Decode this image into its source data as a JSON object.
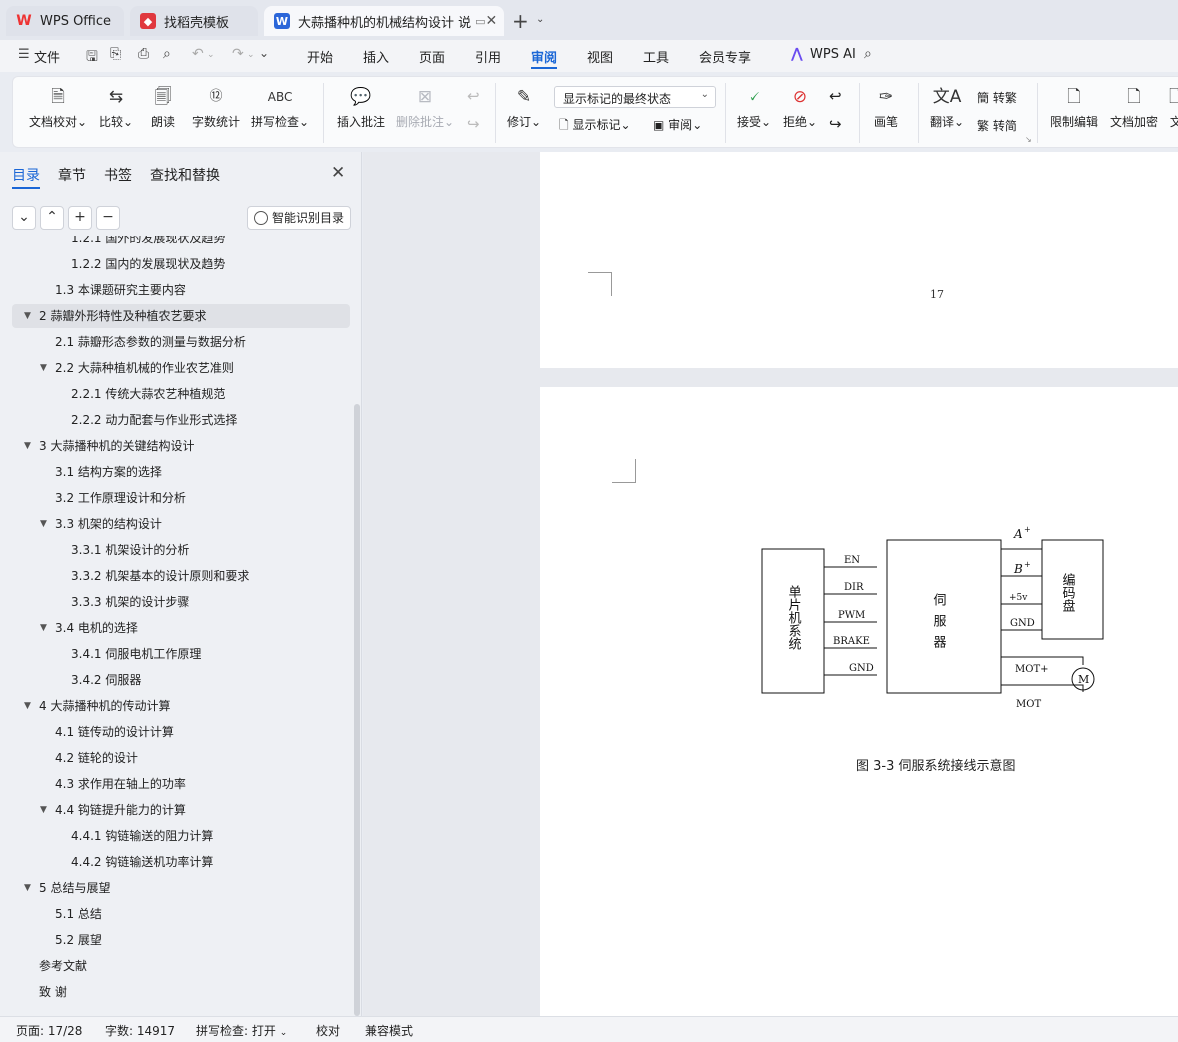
{
  "tabs": [
    {
      "label": "WPS Office"
    },
    {
      "label": "找稻壳模板"
    },
    {
      "label": "大蒜播种机的机械结构设计 说"
    }
  ],
  "menu": {
    "file": "文件",
    "items": [
      "开始",
      "插入",
      "页面",
      "引用",
      "审阅",
      "视图",
      "工具",
      "会员专享"
    ],
    "wps_ai": "WPS AI"
  },
  "ribbon": {
    "proofread": "文档校对",
    "compare": "比较",
    "read_aloud": "朗读",
    "word_count": "字数统计",
    "spell_check": "拼写检查",
    "insert_comment": "插入批注",
    "delete_comment": "删除批注",
    "revise": "修订",
    "markup_state": "显示标记的最终状态",
    "show_markup": "显示标记",
    "review": "审阅",
    "accept": "接受",
    "reject": "拒绝",
    "pen": "画笔",
    "translate": "翻译",
    "to_traditional": "转繁",
    "to_simplified": "转简",
    "restrict_edit": "限制编辑",
    "encrypt": "文档加密",
    "doc_more": "文"
  },
  "nav": {
    "tabs": [
      "目录",
      "章节",
      "书签",
      "查找和替换"
    ],
    "smart_button": "智能识别目录",
    "toc": [
      {
        "label": "1.2.1 国外的发展现状及趋势",
        "level": 3
      },
      {
        "label": "1.2.2 国内的发展现状及趋势",
        "level": 3
      },
      {
        "label": "1.3 本课题研究主要内容",
        "level": 2
      },
      {
        "label": "2  蒜瓣外形特性及种植农艺要求",
        "level": 1,
        "expanded": true,
        "selected": true
      },
      {
        "label": "2.1  蒜瓣形态参数的测量与数据分析",
        "level": 2
      },
      {
        "label": "2.2  大蒜种植机械的作业农艺准则",
        "level": 2,
        "expanded": true
      },
      {
        "label": "2.2.1  传统大蒜农艺种植规范",
        "level": 3
      },
      {
        "label": "2.2.2  动力配套与作业形式选择",
        "level": 3
      },
      {
        "label": "3 大蒜播种机的关键结构设计",
        "level": 1,
        "expanded": true
      },
      {
        "label": "3.1 结构方案的选择",
        "level": 2
      },
      {
        "label": "3.2 工作原理设计和分析",
        "level": 2
      },
      {
        "label": "3.3 机架的结构设计",
        "level": 2,
        "expanded": true
      },
      {
        "label": "3.3.1 机架设计的分析",
        "level": 3
      },
      {
        "label": "3.3.2 机架基本的设计原则和要求",
        "level": 3
      },
      {
        "label": "3.3.3 机架的设计步骤",
        "level": 3
      },
      {
        "label": "3.4 电机的选择",
        "level": 2,
        "expanded": true
      },
      {
        "label": "3.4.1 伺服电机工作原理",
        "level": 3
      },
      {
        "label": "3.4.2 伺服器",
        "level": 3
      },
      {
        "label": "4  大蒜播种机的传动计算",
        "level": 1,
        "expanded": true
      },
      {
        "label": "4.1 链传动的设计计算",
        "level": 2
      },
      {
        "label": "4.2 链轮的设计",
        "level": 2
      },
      {
        "label": "4.3 求作用在轴上的功率",
        "level": 2
      },
      {
        "label": "4.4 钩链提升能力的计算",
        "level": 2,
        "expanded": true
      },
      {
        "label": "4.4.1 钩链输送的阻力计算",
        "level": 3
      },
      {
        "label": "4.4.2 钩链输送机功率计算",
        "level": 3
      },
      {
        "label": "5  总结与展望",
        "level": 1,
        "expanded": true
      },
      {
        "label": "5.1 总结",
        "level": 2
      },
      {
        "label": "5.2 展望",
        "level": 2
      },
      {
        "label": "参考文献",
        "level": 1
      },
      {
        "label": "致   谢",
        "level": 1
      }
    ]
  },
  "document": {
    "page_number": "17",
    "figure": {
      "mcu_label": "单片机系统",
      "servo_label": "伺服器",
      "encoder_label": "编码盘",
      "motor_label": "M",
      "left_signals": [
        "EN",
        "DIR",
        "PWM",
        "BRAKE",
        "GND"
      ],
      "right_signals": [
        "A",
        "B",
        "+5v",
        "GND"
      ],
      "superscript": "+",
      "motor_signals": [
        "MOT+",
        "MOT"
      ],
      "caption": "图 3-3  伺服系统接线示意图"
    }
  },
  "status": {
    "page": "页面: 17/28",
    "words": "字数: 14917",
    "spell": "拼写检查: 打开",
    "proof": "校对",
    "compat": "兼容模式"
  }
}
